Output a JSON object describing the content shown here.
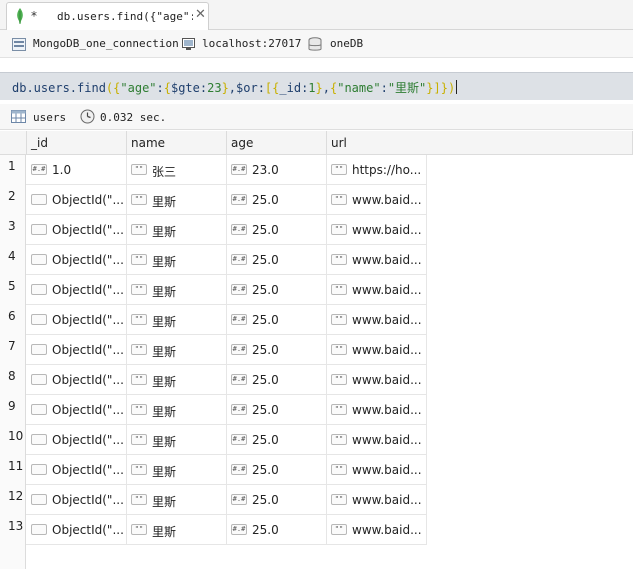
{
  "tab": {
    "dirty_marker": "*",
    "title": "db.users.find({\"age\":…"
  },
  "connection": {
    "name": "MongoDB_one_connection",
    "host": "localhost:27017",
    "database": "oneDB"
  },
  "query": {
    "text": "db.users.find({\"age\":{$gte:23},$or:[{_id:1},{\"name\":\"里斯\"}]})"
  },
  "results": {
    "collection": "users",
    "elapsed": "0.032 sec."
  },
  "colors": {
    "query_background": "#dde1e6",
    "mongo_leaf": "#4caf50"
  },
  "columns": [
    "_id",
    "name",
    "age",
    "url"
  ],
  "rows": [
    {
      "num": "1",
      "id": "1.0",
      "name": "张三",
      "age": "23.0",
      "url": "https://ho..."
    },
    {
      "num": "2",
      "id": "ObjectId(\"...",
      "name": "里斯",
      "age": "25.0",
      "url": "www.baid..."
    },
    {
      "num": "3",
      "id": "ObjectId(\"...",
      "name": "里斯",
      "age": "25.0",
      "url": "www.baid..."
    },
    {
      "num": "4",
      "id": "ObjectId(\"...",
      "name": "里斯",
      "age": "25.0",
      "url": "www.baid..."
    },
    {
      "num": "5",
      "id": "ObjectId(\"...",
      "name": "里斯",
      "age": "25.0",
      "url": "www.baid..."
    },
    {
      "num": "6",
      "id": "ObjectId(\"...",
      "name": "里斯",
      "age": "25.0",
      "url": "www.baid..."
    },
    {
      "num": "7",
      "id": "ObjectId(\"...",
      "name": "里斯",
      "age": "25.0",
      "url": "www.baid..."
    },
    {
      "num": "8",
      "id": "ObjectId(\"...",
      "name": "里斯",
      "age": "25.0",
      "url": "www.baid..."
    },
    {
      "num": "9",
      "id": "ObjectId(\"...",
      "name": "里斯",
      "age": "25.0",
      "url": "www.baid..."
    },
    {
      "num": "10",
      "id": "ObjectId(\"...",
      "name": "里斯",
      "age": "25.0",
      "url": "www.baid..."
    },
    {
      "num": "11",
      "id": "ObjectId(\"...",
      "name": "里斯",
      "age": "25.0",
      "url": "www.baid..."
    },
    {
      "num": "12",
      "id": "ObjectId(\"...",
      "name": "里斯",
      "age": "25.0",
      "url": "www.baid..."
    },
    {
      "num": "13",
      "id": "ObjectId(\"...",
      "name": "里斯",
      "age": "25.0",
      "url": "www.baid..."
    }
  ],
  "type_badges": {
    "number": "#.#",
    "string": "\"\"",
    "object": ""
  }
}
